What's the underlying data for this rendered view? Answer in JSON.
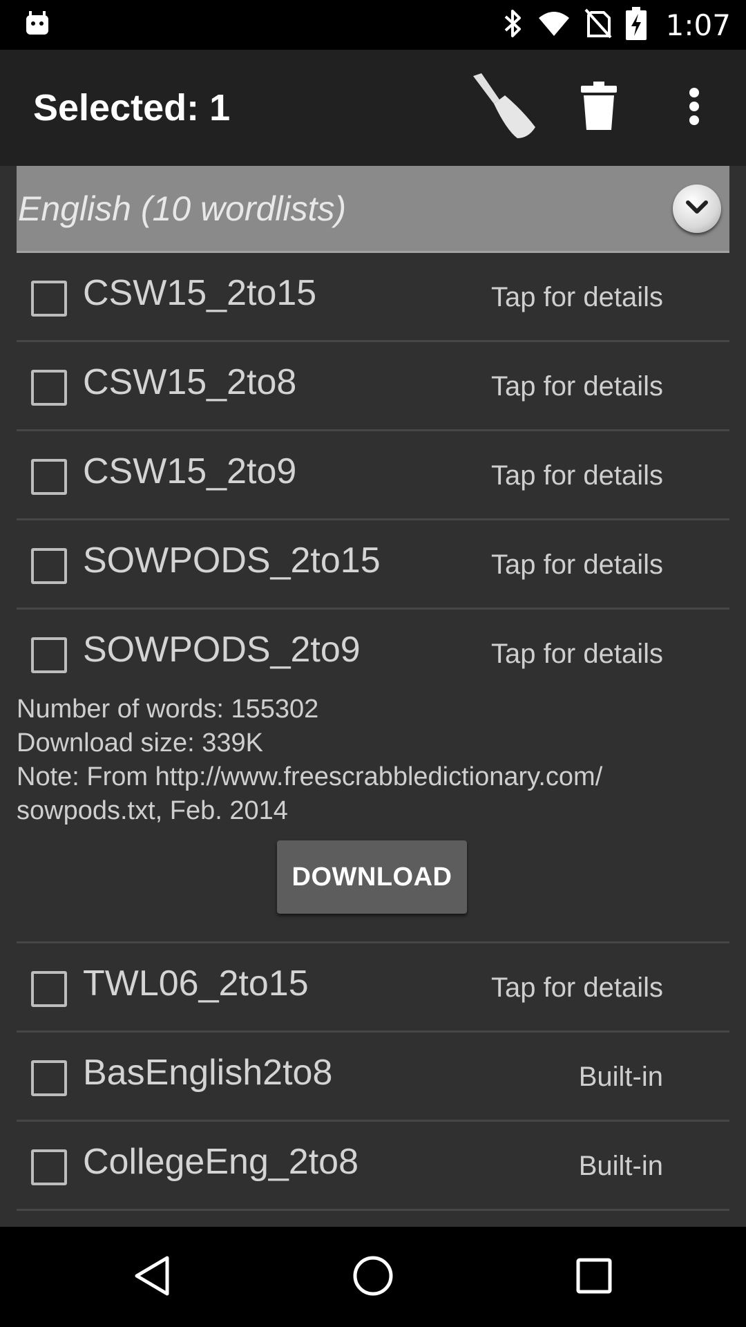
{
  "status_bar": {
    "time": "1:07",
    "icons": [
      "android-icon",
      "bluetooth-icon",
      "wifi-icon",
      "no-sim-icon",
      "battery-charging-icon"
    ]
  },
  "action_bar": {
    "title": "Selected: 1",
    "actions": [
      "broom-icon",
      "trash-icon",
      "overflow-menu-icon"
    ]
  },
  "group": {
    "title": "English (10 wordlists)"
  },
  "wordlists": [
    {
      "name": "CSW15_2to15",
      "status": "Tap for details"
    },
    {
      "name": "CSW15_2to8",
      "status": "Tap for details"
    },
    {
      "name": "CSW15_2to9",
      "status": "Tap for details"
    },
    {
      "name": "SOWPODS_2to15",
      "status": "Tap for details"
    },
    {
      "name": "SOWPODS_2to9",
      "status": "Tap for details",
      "details": {
        "words": "Number of words: 155302",
        "size": "Download size: 339K",
        "note_line1": "Note: From http://www.freescrabbledictionary.com/",
        "note_line2": "sowpods.txt, Feb. 2014",
        "button": "DOWNLOAD"
      }
    },
    {
      "name": "TWL06_2to15",
      "status": "Tap for details"
    },
    {
      "name": "BasEnglish2to8",
      "status": "Built-in"
    },
    {
      "name": "CollegeEng_2to8",
      "status": "Built-in"
    }
  ],
  "nav_bar": [
    "back-icon",
    "home-icon",
    "recents-icon"
  ]
}
